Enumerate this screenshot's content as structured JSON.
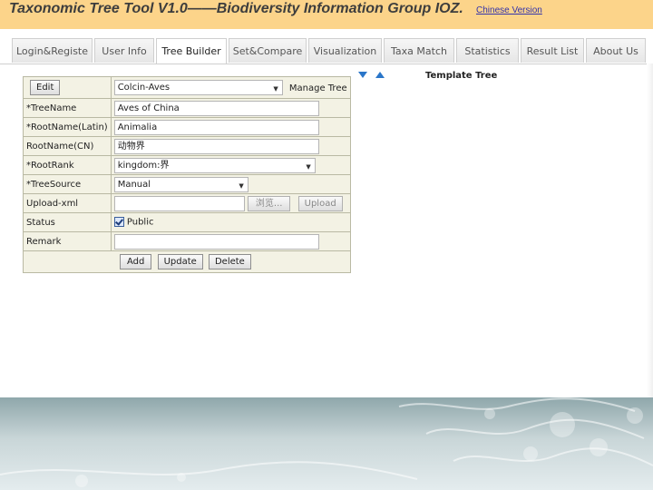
{
  "header": {
    "title": "Taxonomic Tree Tool V1.0——Biodiversity Information Group IOZ.",
    "language_link": "Chinese Version"
  },
  "tabs": [
    {
      "label": "Login&Registe",
      "active": false
    },
    {
      "label": "User Info",
      "active": false
    },
    {
      "label": "Tree Builder",
      "active": true
    },
    {
      "label": "Set&Compare",
      "active": false
    },
    {
      "label": "Visualization",
      "active": false
    },
    {
      "label": "Taxa Match",
      "active": false
    },
    {
      "label": "Statistics",
      "active": false
    },
    {
      "label": "Result List",
      "active": false
    },
    {
      "label": "About Us",
      "active": false
    }
  ],
  "form": {
    "edit_button": "Edit",
    "tree_select_value": "Colcin-Aves",
    "manage_tree_label": "Manage Tree",
    "tree_name_label": "*TreeName",
    "tree_name_value": "Aves of China",
    "root_name_latin_label": "*RootName(Latin)",
    "root_name_latin_value": "Animalia",
    "root_name_cn_label": "RootName(CN)",
    "root_name_cn_value": "动物界",
    "root_rank_label": "*RootRank",
    "root_rank_value": "kingdom:界",
    "tree_source_label": "*TreeSource",
    "tree_source_value": "Manual",
    "upload_xml_label": "Upload-xml",
    "browse_button": "浏览...",
    "upload_button": "Upload",
    "status_label": "Status",
    "public_label": "Public",
    "remark_label": "Remark",
    "remark_value": "",
    "add_button": "Add",
    "update_button": "Update",
    "delete_button": "Delete"
  },
  "template_tree": {
    "title": "Template Tree"
  },
  "colors": {
    "header_bg": "#fcd48a",
    "table_bg": "#f3f2e4",
    "link": "#3333aa",
    "arrow_icons": "#2a76c9"
  }
}
